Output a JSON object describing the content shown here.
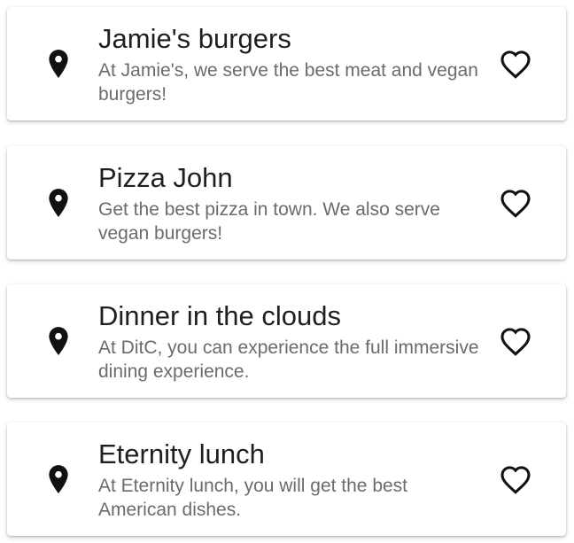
{
  "restaurants": [
    {
      "name": "Jamie's burgers",
      "description": "At Jamie's, we serve the best meat and vegan burgers!",
      "location_icon": "location-pin-icon",
      "favorite_icon": "heart-outline-icon"
    },
    {
      "name": "Pizza John",
      "description": "Get the best pizza in town. We also serve vegan burgers!",
      "location_icon": "location-pin-icon",
      "favorite_icon": "heart-outline-icon"
    },
    {
      "name": "Dinner in the clouds",
      "description": "At DitC, you can experience the full immersive dining experience.",
      "location_icon": "location-pin-icon",
      "favorite_icon": "heart-outline-icon"
    },
    {
      "name": "Eternity lunch",
      "description": "At Eternity lunch, you will get the best American dishes.",
      "location_icon": "location-pin-icon",
      "favorite_icon": "heart-outline-icon"
    }
  ],
  "colors": {
    "title": "#1f1f1f",
    "description": "#6b6b6b",
    "icon": "#111111",
    "card_background": "#ffffff"
  }
}
